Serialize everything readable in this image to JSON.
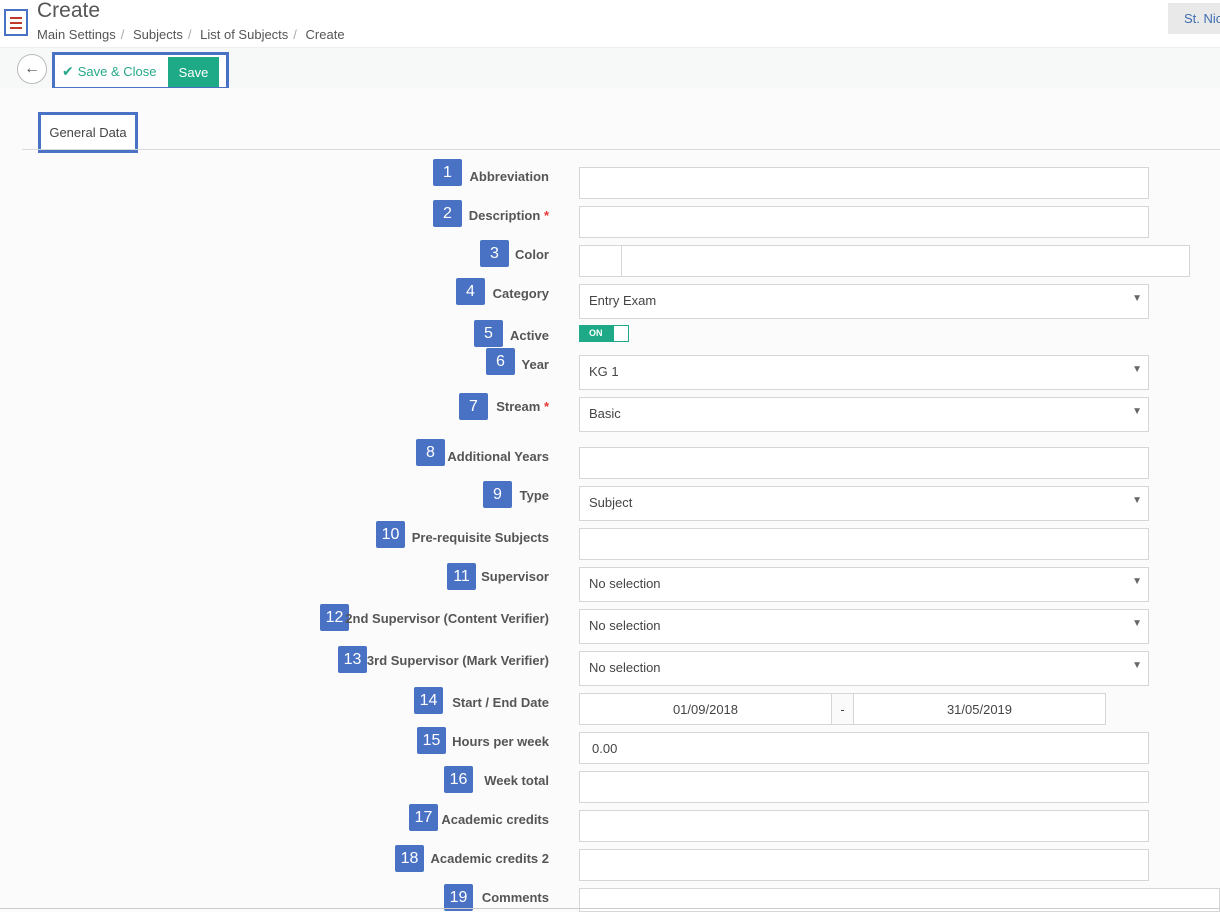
{
  "header": {
    "title": "Create",
    "breadcrumb": [
      "Main Settings",
      "Subjects",
      "List of Subjects",
      "Create"
    ],
    "school_button": "St. Nic"
  },
  "toolbar": {
    "save_close_label": "Save & Close",
    "save_label": "Save"
  },
  "tabs": {
    "general": "General Data"
  },
  "form": {
    "abbreviation": {
      "num": "1",
      "label": "Abbreviation",
      "value": ""
    },
    "description": {
      "num": "2",
      "label": "Description",
      "required": "*",
      "value": ""
    },
    "color": {
      "num": "3",
      "label": "Color",
      "value": ""
    },
    "category": {
      "num": "4",
      "label": "Category",
      "value": "Entry Exam"
    },
    "active": {
      "num": "5",
      "label": "Active",
      "toggle": "ON"
    },
    "year": {
      "num": "6",
      "label": "Year",
      "value": "KG 1"
    },
    "stream": {
      "num": "7",
      "label": "Stream",
      "required": "*",
      "value": "Basic"
    },
    "additional_years": {
      "num": "8",
      "label": "Additional Years",
      "value": ""
    },
    "type": {
      "num": "9",
      "label": "Type",
      "value": "Subject"
    },
    "prerequisite": {
      "num": "10",
      "label": "Pre-requisite Subjects",
      "value": ""
    },
    "supervisor": {
      "num": "11",
      "label": "Supervisor",
      "value": "No selection"
    },
    "supervisor2": {
      "num": "12",
      "label": "2nd Supervisor (Content Verifier)",
      "value": "No selection"
    },
    "supervisor3": {
      "num": "13",
      "label": "3rd Supervisor (Mark Verifier)",
      "value": "No selection"
    },
    "dates": {
      "num": "14",
      "label": "Start / End Date",
      "start": "01/09/2018",
      "sep": "-",
      "end": "31/05/2019"
    },
    "hours": {
      "num": "15",
      "label": "Hours per week",
      "value": "0.00"
    },
    "week_total": {
      "num": "16",
      "label": "Week total",
      "value": ""
    },
    "credits": {
      "num": "17",
      "label": "Academic credits",
      "value": ""
    },
    "credits2": {
      "num": "18",
      "label": "Academic credits 2",
      "value": ""
    },
    "comments": {
      "num": "19",
      "label": "Comments",
      "value": ""
    }
  },
  "icons": {
    "menu": "hamburger-icon",
    "back": "arrow-left-icon",
    "check": "check-icon",
    "caret": "caret-down-icon"
  },
  "colors": {
    "accent_green": "#1eaa86",
    "highlight_blue": "#4a72c4",
    "arrow_red": "#d9443a"
  }
}
